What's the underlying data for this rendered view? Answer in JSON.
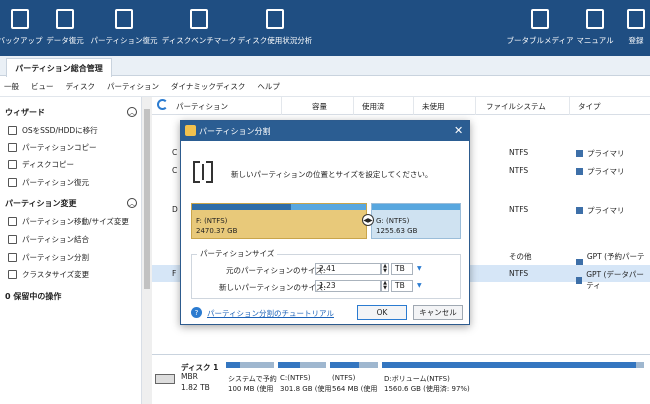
{
  "toolbar": {
    "items": [
      {
        "label": "バックアップ"
      },
      {
        "label": "データ復元"
      },
      {
        "label": "パーティション復元"
      },
      {
        "label": "ディスクベンチマーク"
      },
      {
        "label": "ディスク使用状況分析"
      },
      {
        "label": "ブータブルメディア"
      },
      {
        "label": "マニュアル"
      },
      {
        "label": "登録"
      }
    ]
  },
  "tab": {
    "label": "パーティション総合管理"
  },
  "menu": [
    "一般",
    "ビュー",
    "ディスク",
    "パーティション",
    "ダイナミックディスク",
    "ヘルプ"
  ],
  "sidebar": {
    "wizard_title": "ウィザード",
    "wizard_items": [
      "OSをSSD/HDDに移行",
      "パーティションコピー",
      "ディスクコピー",
      "パーティション復元"
    ],
    "change_title": "パーティション変更",
    "change_items": [
      "パーティション移動/サイズ変更",
      "パーティション結合",
      "パーティション分割",
      "クラスタサイズ変更"
    ],
    "pending": "0 保留中の操作"
  },
  "table": {
    "headers": [
      "パーティション",
      "容量",
      "使用済",
      "未使用",
      "ファイルシステム",
      "タイプ"
    ],
    "rows": [
      {
        "first": "C",
        "fs": "NTFS",
        "type": "プライマリ"
      },
      {
        "first": "C",
        "fs": "NTFS",
        "type": "プライマリ"
      },
      {
        "first": "D",
        "fs": "NTFS",
        "type": "プライマリ"
      },
      {
        "first": "",
        "fs": "その他",
        "type": "GPT (予約パーティ"
      },
      {
        "first": "F",
        "fs": "NTFS",
        "type": "GPT (データパーティ"
      }
    ]
  },
  "disk": {
    "name": "ディスク 1",
    "scheme": "MBR",
    "size": "1.82 TB",
    "parts": [
      {
        "t1": "システムで予約",
        "t2": "100 MB (使用"
      },
      {
        "t1": "C:(NTFS)",
        "t2": "301.8 GB (使用"
      },
      {
        "t1": "(NTFS)",
        "t2": "564 MB (使用"
      },
      {
        "t1": "D:ボリューム(NTFS)",
        "t2": "1560.6 GB (使用済: 97%)"
      }
    ]
  },
  "dialog": {
    "title": "パーティション分割",
    "close": "✕",
    "description": "新しいパーティションの位置とサイズを設定してください。",
    "left": {
      "name": "F: (NTFS)",
      "size": "2470.37 GB",
      "used_fraction": 0.57
    },
    "right": {
      "name": "G: (NTFS)",
      "size": "1255.63 GB"
    },
    "group_title": "パーティションサイズ",
    "original_label": "元のパーティションのサイズ:",
    "original_value": "2.41",
    "new_label": "新しいパーティションのサイズ:",
    "new_value": "1.23",
    "unit": "TB",
    "help_link": "パーティション分割のチュートリアル",
    "ok": "OK",
    "cancel": "キャンセル"
  }
}
